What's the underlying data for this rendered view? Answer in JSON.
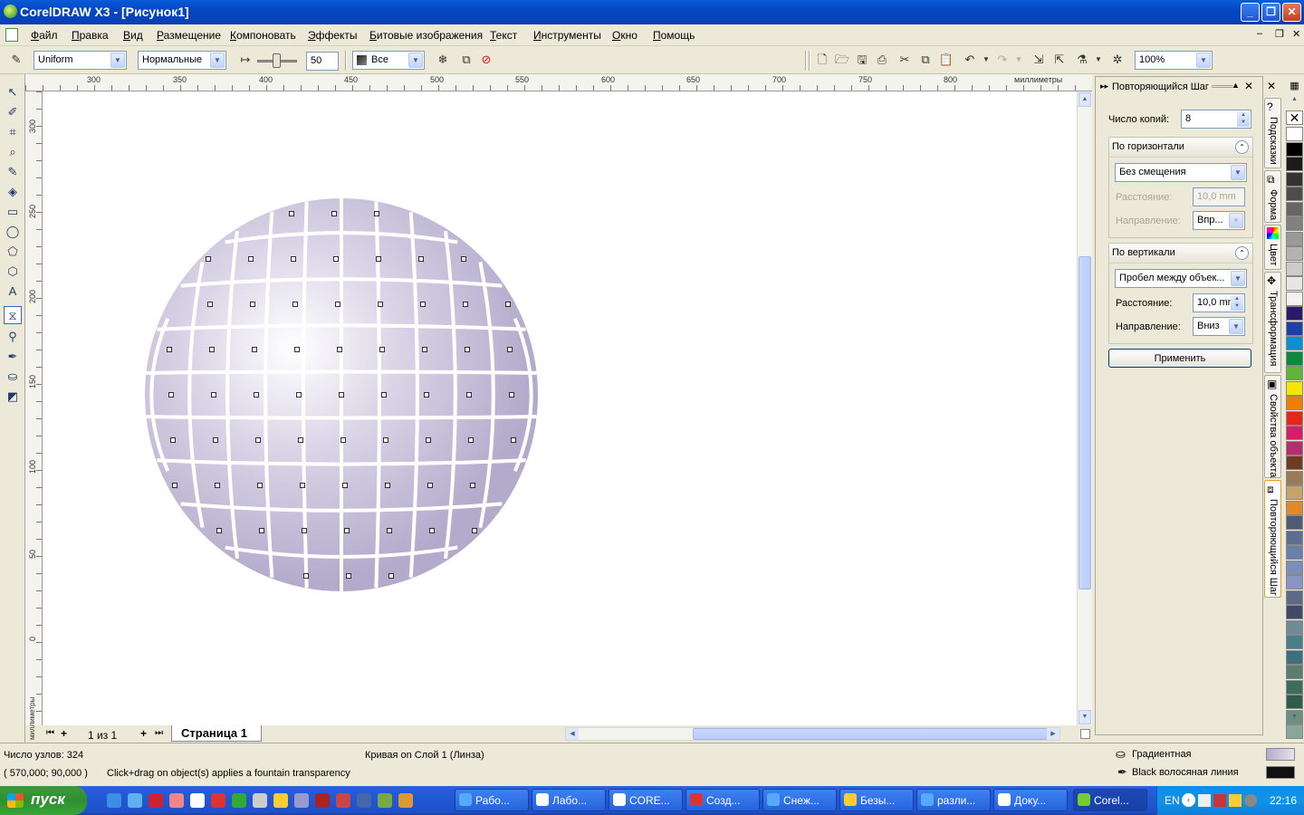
{
  "window": {
    "title": "CorelDRAW X3 - [Рисунок1]"
  },
  "menu": [
    "Файл",
    "Правка",
    "Вид",
    "Размещение",
    "Компоновать",
    "Эффекты",
    "Битовые изображения",
    "Текст",
    "Инструменты",
    "Окно",
    "Помощь"
  ],
  "propbar": {
    "transparency_type": "Uniform",
    "operation": "Нормальные",
    "slider_value": "50",
    "target": "Все",
    "zoom": "100%"
  },
  "ruler": {
    "units": "миллиметры",
    "h_labels": [
      "300",
      "350",
      "400",
      "450",
      "500",
      "550",
      "600",
      "650",
      "700",
      "750",
      "800"
    ],
    "v_labels": [
      "300",
      "250",
      "200",
      "150",
      "100",
      "50",
      "0"
    ]
  },
  "page_nav": {
    "count": "1 из 1",
    "page_tab": "Страница 1"
  },
  "docker": {
    "title": "Повторяющийся Шаг",
    "copies_label": "Число копий:",
    "copies_value": "8",
    "horizontal": {
      "header": "По горизонтали",
      "mode": "Без смещения",
      "distance_label": "Расстояние:",
      "distance_value": "10,0 mm",
      "direction_label": "Направление:",
      "direction_value": "Впр..."
    },
    "vertical": {
      "header": "По вертикали",
      "mode": "Пробел между объек...",
      "distance_label": "Расстояние:",
      "distance_value": "10,0 mm",
      "direction_label": "Направление:",
      "direction_value": "Вниз"
    },
    "apply_label": "Применить"
  },
  "vtabs": [
    "Подсказки",
    "Форма",
    "Цвет",
    "Трансформация",
    "Свойства объекта",
    "Повторяющийся Шаг"
  ],
  "palette_colors": [
    "#ffffff",
    "#000000",
    "#1a1a1a",
    "#333333",
    "#4d4d4d",
    "#666666",
    "#808080",
    "#999999",
    "#b3b3b3",
    "#cccccc",
    "#e6e6e6",
    "#f2f2f2",
    "#2a1a6b",
    "#1f3fa8",
    "#0b8fd1",
    "#0a8a3c",
    "#63b23a",
    "#f5e600",
    "#f07f00",
    "#e4261b",
    "#d61e68",
    "#b82c6e",
    "#6e3b22",
    "#9b7a5a",
    "#c9a26b",
    "#e08a2a",
    "#505a73",
    "#5b6f8e",
    "#6a7fa8",
    "#7b8fbd",
    "#8795c2",
    "#5c6a86",
    "#3f4b66",
    "#6d8c95",
    "#4a7e8b",
    "#3d6f7d",
    "#5a7d6e",
    "#3f6d5b",
    "#2f5d4b",
    "#6c8f7f",
    "#8aa89a"
  ],
  "status": {
    "nodes": "Число узлов: 324",
    "object": "Кривая on Слой 1  (Линза)",
    "coords": "( 570,000; 90,000 )",
    "hint": "Click+drag on object(s) applies a fountain transparency",
    "fill_label": "Градиентная",
    "outline_label": "Black  волосяная линия"
  },
  "taskbar": {
    "start_label": "пуск",
    "tasks": [
      "Рабо...",
      "Лабо...",
      "CORE...",
      "Созд...",
      "Снеж...",
      "Безы...",
      "разли...",
      "Доку...",
      "Corel..."
    ],
    "lang": "EN",
    "clock": "22:16"
  }
}
